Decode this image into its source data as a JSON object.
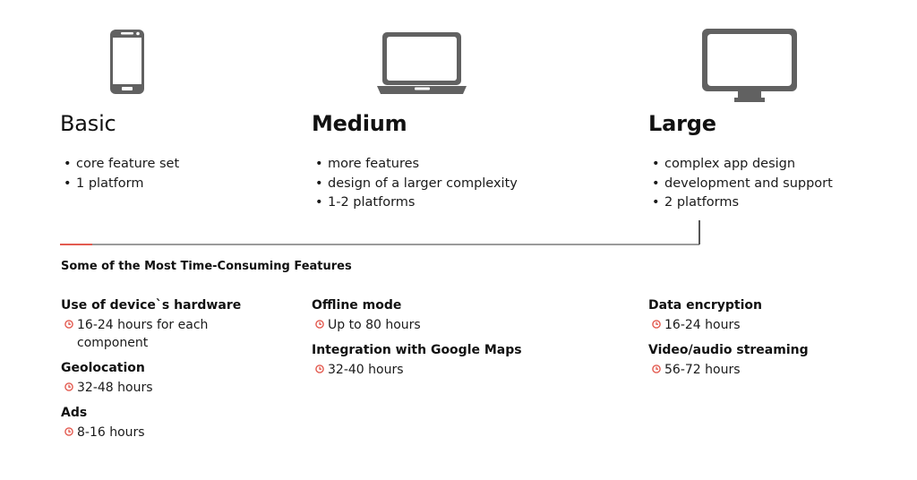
{
  "tiers": [
    {
      "icon": "smartphone-icon",
      "title": "Basic",
      "bullets": [
        "core feature set",
        "1 platform"
      ]
    },
    {
      "icon": "laptop-icon",
      "title": "Medium",
      "bullets": [
        "more features",
        "design of a larger complexity",
        "1-2 platforms"
      ]
    },
    {
      "icon": "monitor-icon",
      "title": "Large",
      "bullets": [
        "complex app design",
        "development and support",
        "2 platforms"
      ]
    }
  ],
  "bullet_char": "•",
  "section_title": "Some of the Most Time-Consuming Features",
  "colors": {
    "accent": "#e35b50",
    "icon_gray": "#616161",
    "line_gray": "#9b9b9b",
    "text": "#111111"
  },
  "features": {
    "col1": [
      {
        "name": "Use of device`s hardware",
        "time": "16-24 hours for each component"
      },
      {
        "name": "Geolocation",
        "time": "32-48 hours"
      },
      {
        "name": "Ads",
        "time": "8-16 hours"
      }
    ],
    "col2": [
      {
        "name": "Offline mode",
        "time": "Up to 80 hours"
      },
      {
        "name": "Integration with Google Maps",
        "time": "32-40 hours"
      }
    ],
    "col3": [
      {
        "name": "Data encryption",
        "time": "16-24 hours"
      },
      {
        "name": "Video/audio streaming",
        "time": "56-72 hours"
      }
    ]
  }
}
